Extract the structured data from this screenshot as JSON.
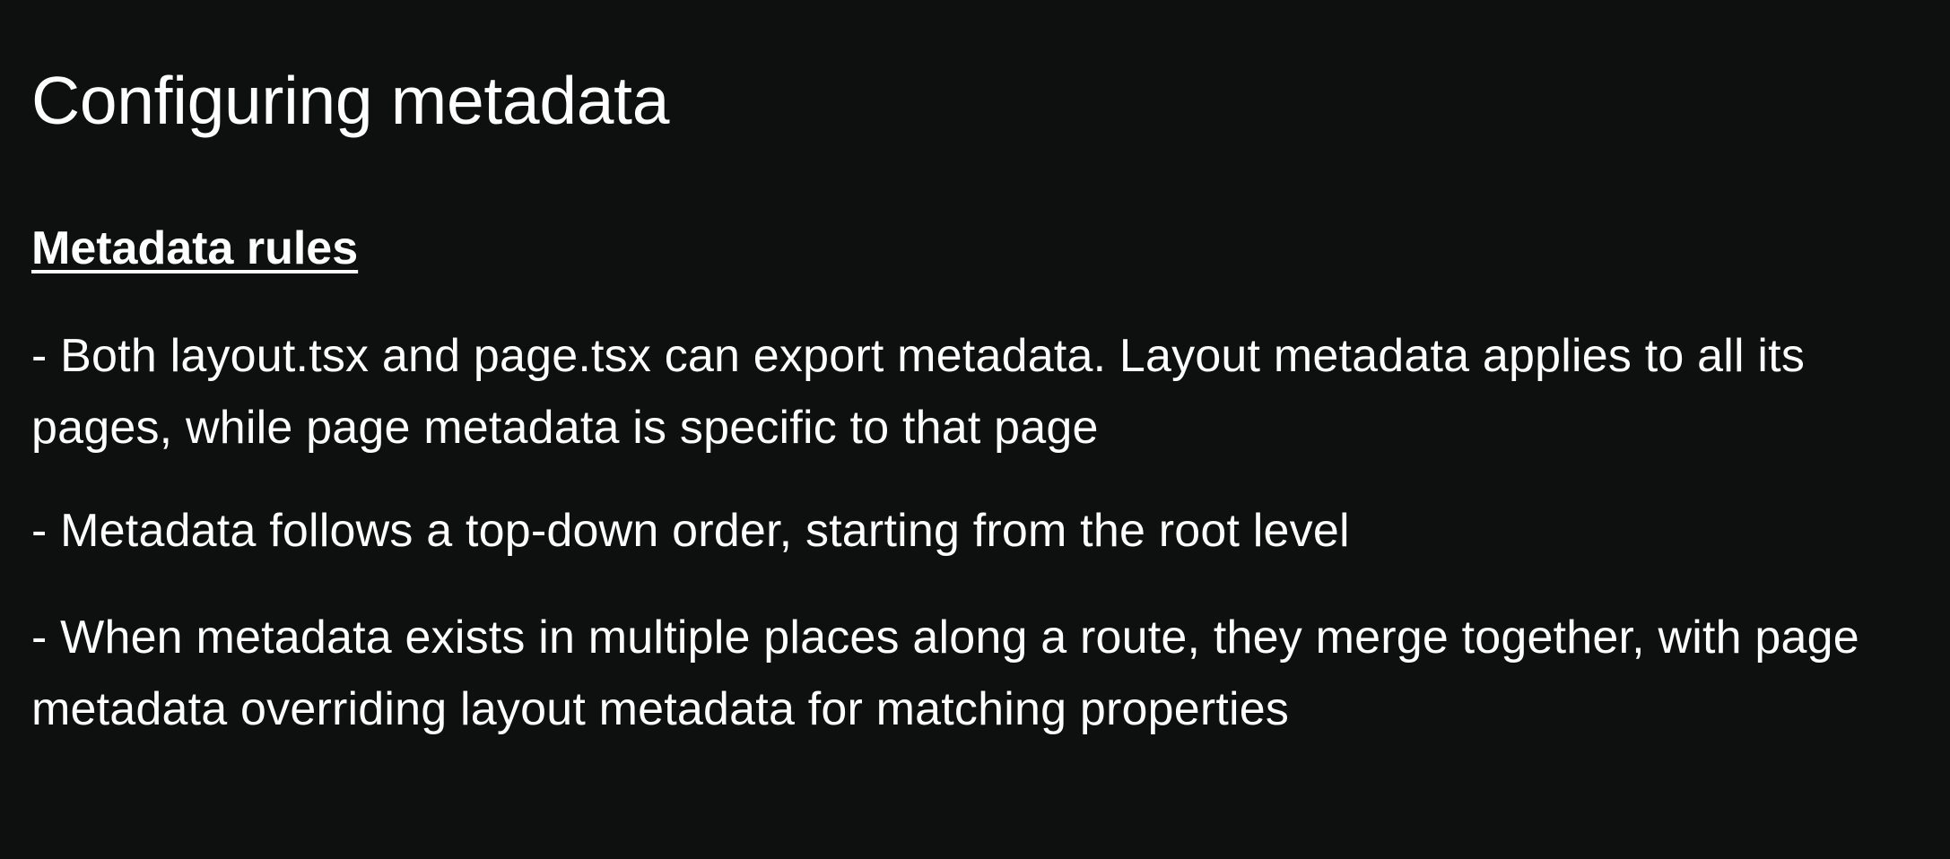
{
  "slide": {
    "title": "Configuring metadata",
    "subtitle": "Metadata rules",
    "rules": [
      "- Both layout.tsx and page.tsx can export metadata. Layout metadata applies to all its pages, while page metadata is specific to that page",
      "- Metadata follows a top-down order, starting from the root level",
      "- When metadata exists in multiple places along a route, they merge together, with page metadata overriding layout metadata for matching properties"
    ]
  },
  "colors": {
    "background": "#0e0f0f",
    "text": "#ffffff"
  }
}
